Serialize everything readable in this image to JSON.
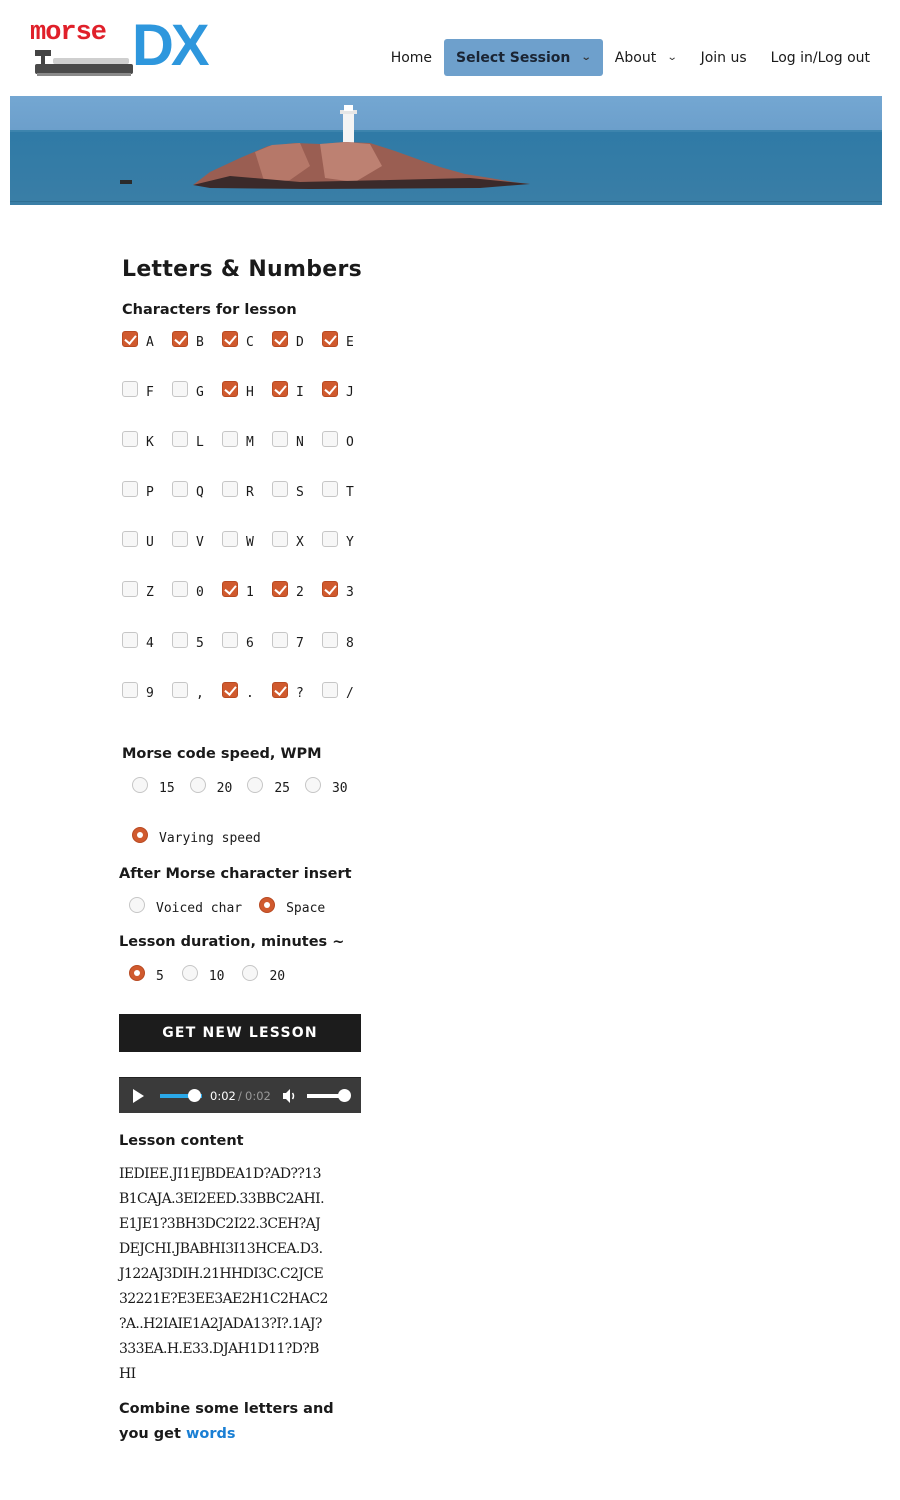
{
  "header": {
    "logo": {
      "text_morse": "morse",
      "text_dx": "DX",
      "alt": "morseDX logo"
    },
    "nav": [
      {
        "label": "Home",
        "active": false,
        "has_dropdown": false
      },
      {
        "label": "Select Session",
        "active": true,
        "has_dropdown": true
      },
      {
        "label": "About",
        "active": false,
        "has_dropdown": true
      },
      {
        "label": "Join us",
        "active": false,
        "has_dropdown": false
      },
      {
        "label": "Log in/Log out",
        "active": false,
        "has_dropdown": false
      }
    ],
    "dropdown_icon": "chevron-down-icon"
  },
  "banner": {
    "description": "lighthouse on rocky island at sea"
  },
  "page": {
    "title": "Letters & Numbers",
    "characters_label": "Characters for lesson",
    "characters": [
      {
        "char": "A",
        "checked": true
      },
      {
        "char": "B",
        "checked": true
      },
      {
        "char": "C",
        "checked": true
      },
      {
        "char": "D",
        "checked": true
      },
      {
        "char": "E",
        "checked": true
      },
      {
        "char": "F",
        "checked": false
      },
      {
        "char": "G",
        "checked": false
      },
      {
        "char": "H",
        "checked": true
      },
      {
        "char": "I",
        "checked": true
      },
      {
        "char": "J",
        "checked": true
      },
      {
        "char": "K",
        "checked": false
      },
      {
        "char": "L",
        "checked": false
      },
      {
        "char": "M",
        "checked": false
      },
      {
        "char": "N",
        "checked": false
      },
      {
        "char": "O",
        "checked": false
      },
      {
        "char": "P",
        "checked": false
      },
      {
        "char": "Q",
        "checked": false
      },
      {
        "char": "R",
        "checked": false
      },
      {
        "char": "S",
        "checked": false
      },
      {
        "char": "T",
        "checked": false
      },
      {
        "char": "U",
        "checked": false
      },
      {
        "char": "V",
        "checked": false
      },
      {
        "char": "W",
        "checked": false
      },
      {
        "char": "X",
        "checked": false
      },
      {
        "char": "Y",
        "checked": false
      },
      {
        "char": "Z",
        "checked": false
      },
      {
        "char": "0",
        "checked": false
      },
      {
        "char": "1",
        "checked": true
      },
      {
        "char": "2",
        "checked": true
      },
      {
        "char": "3",
        "checked": true
      },
      {
        "char": "4",
        "checked": false
      },
      {
        "char": "5",
        "checked": false
      },
      {
        "char": "6",
        "checked": false
      },
      {
        "char": "7",
        "checked": false
      },
      {
        "char": "8",
        "checked": false
      },
      {
        "char": "9",
        "checked": false
      },
      {
        "char": ",",
        "checked": false
      },
      {
        "char": ".",
        "checked": true
      },
      {
        "char": "?",
        "checked": true
      },
      {
        "char": "/",
        "checked": false
      }
    ],
    "speed_label": "Morse code speed, WPM",
    "speed_options": [
      {
        "label": "15",
        "checked": false
      },
      {
        "label": "20",
        "checked": false
      },
      {
        "label": "25",
        "checked": false
      },
      {
        "label": "30",
        "checked": false
      }
    ],
    "varying_speed": {
      "label": "Varying speed",
      "checked": true
    },
    "insert_label": "After Morse character insert",
    "insert_options": [
      {
        "label": "Voiced char",
        "checked": false
      },
      {
        "label": "Space",
        "checked": true
      }
    ],
    "duration_label": "Lesson duration, minutes ~",
    "duration_options": [
      {
        "label": "5",
        "checked": true
      },
      {
        "label": "10",
        "checked": false
      },
      {
        "label": "20",
        "checked": false
      }
    ],
    "get_lesson_button": "GET NEW LESSON",
    "audio": {
      "current_time": "0:02",
      "separator": "/",
      "duration": "0:02",
      "progress": 1.0,
      "volume": 1.0
    },
    "lesson_content_label": "Lesson content",
    "lesson_lines": [
      "IEDIEE.JI1EJBDEA1D?AD??13",
      "B1CAJA.3EI2EED.33BBC2AHI.",
      "E1JE1?3BH3DC2I22.3CEH?AJ",
      "DEJCHI.JBABHI3I13HCEA.D3.",
      "J122AJ3DIH.21HHDI3C.C2JCE",
      "32221E?E3EE3AE2H1C2HAC2",
      "?A..H2IAIE1A2JADA13?I?.1AJ?",
      "333EA.H.E33.DJAH1D11?D?B",
      "HI"
    ],
    "combine_text": "Combine some letters and you get ",
    "combine_link": "words"
  },
  "colors": {
    "accent_checked": "#d05a2e",
    "nav_active_bg": "#6ea0cc",
    "link": "#1a7fd4",
    "logo_red": "#e0202a",
    "logo_blue": "#2e97dd",
    "progress_blue": "#2aa8e8"
  }
}
